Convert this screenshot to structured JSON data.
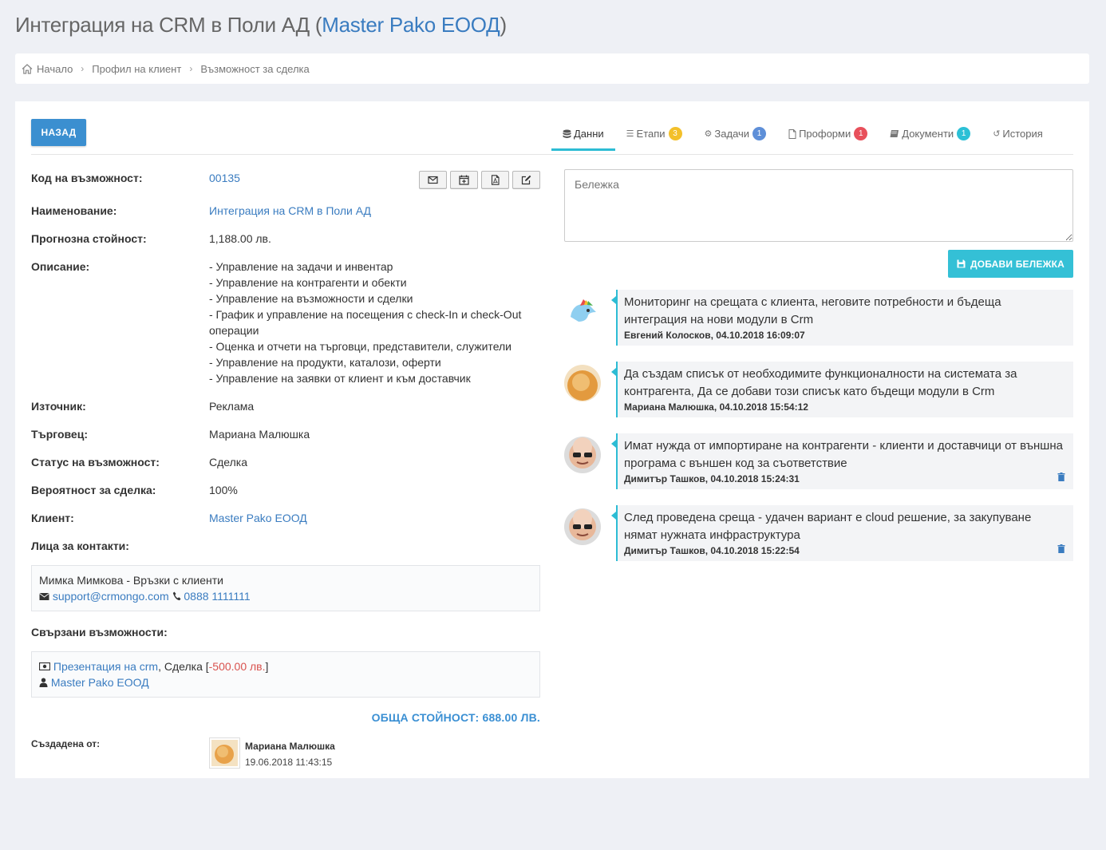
{
  "header": {
    "title_main": "Интеграция на CRM в Поли АД (",
    "title_client": "Master Pako ЕООД",
    "title_end": ")"
  },
  "breadcrumb": {
    "home_icon": "home-icon",
    "items": [
      "Начало",
      "Профил на клиент",
      "Възможност за сделка"
    ]
  },
  "toolbar": {
    "back_label": "НАЗАД"
  },
  "tabs": [
    {
      "label": "Данни",
      "icon": "database-icon",
      "badge": ""
    },
    {
      "label": "Етапи",
      "icon": "list-icon",
      "badge": "3",
      "badge_color": "#f3c02a"
    },
    {
      "label": "Задачи",
      "icon": "gear-icon",
      "badge": "1",
      "badge_color": "#5e8fd8"
    },
    {
      "label": "Проформи",
      "icon": "file-icon",
      "badge": "1",
      "badge_color": "#e8505b"
    },
    {
      "label": "Документи",
      "icon": "book-icon",
      "badge": "1",
      "badge_color": "#2cc0d6"
    },
    {
      "label": "История",
      "icon": "history-icon",
      "badge": ""
    }
  ],
  "details": {
    "code_label": "Код на възможност:",
    "code_value": "00135",
    "name_label": "Наименование:",
    "name_value": "Интеграция на CRM в Поли АД",
    "forecast_label": "Прогнозна стойност:",
    "forecast_value": "1,188.00 лв.",
    "description_label": "Описание:",
    "description_lines": [
      "- Управление на задачи и инвентар",
      "- Управление на контрагенти и обекти",
      "- Управление на възможности и сделки",
      "- График и управление на посещения с check-In и check-Out операции",
      "- Оценка и отчети на търговци, представители, служители",
      "- Управление на продукти, каталози, оферти",
      "- Управление на заявки от клиент и към доставчик"
    ],
    "source_label": "Източник:",
    "source_value": "Реклама",
    "salesman_label": "Търговец:",
    "salesman_value": "Мариана Малюшка",
    "status_label": "Статус на възможност:",
    "status_value": "Сделка",
    "probability_label": "Вероятност за сделка:",
    "probability_value": "100%",
    "client_label": "Клиент:",
    "client_value": "Master Pako ЕООД",
    "contacts_label": "Лица за контакти:",
    "contact_name": "Мимка Мимкова - Връзки с клиенти",
    "contact_email": "support@crmongo.com",
    "contact_phone": "0888 1111111",
    "related_label": "Свързани възможности:",
    "related_title": "Презентация на crm",
    "related_status": ", Сделка [",
    "related_amount": "-500.00 лв.",
    "related_end": "]",
    "related_client": "Master Pako ЕООД",
    "total_label": "ОБЩА СТОЙНОСТ: 688.00 ЛВ.",
    "created_label": "Създадена от:",
    "created_by": "Мариана Малюшка",
    "created_date": "19.06.2018 11:43:15"
  },
  "note_form": {
    "placeholder": "Бележка",
    "add_label": "ДОБАВИ БЕЛЕЖКА"
  },
  "notes": [
    {
      "text": "Мониторинг на срещата с клиента, неговите потребности и бъдеща интеграция на нови модули в Crm",
      "meta": "Евгений Колосков, 04.10.2018 16:09:07",
      "deletable": false
    },
    {
      "text": "Да създам списък от необходимите функционалности на системата за контрагента, Да се добави този списък като бъдещи модули в Crm",
      "meta": "Мариана Малюшка, 04.10.2018 15:54:12",
      "deletable": false
    },
    {
      "text": "Имат нужда от импортиране на контрагенти - клиенти и доставчици от външна програма с външен код за съответствие",
      "meta": "Димитър Ташков, 04.10.2018 15:24:31",
      "deletable": true
    },
    {
      "text": "След проведена среща - удачен вариант е cloud решение, за закупуване нямат нужната инфраструктура",
      "meta": "Димитър Ташков, 04.10.2018 15:22:54",
      "deletable": true
    }
  ],
  "colors": {
    "primary": "#3b8fd0",
    "accent": "#2dbcd4",
    "link": "#3a7cc0",
    "negative": "#d9534f"
  }
}
